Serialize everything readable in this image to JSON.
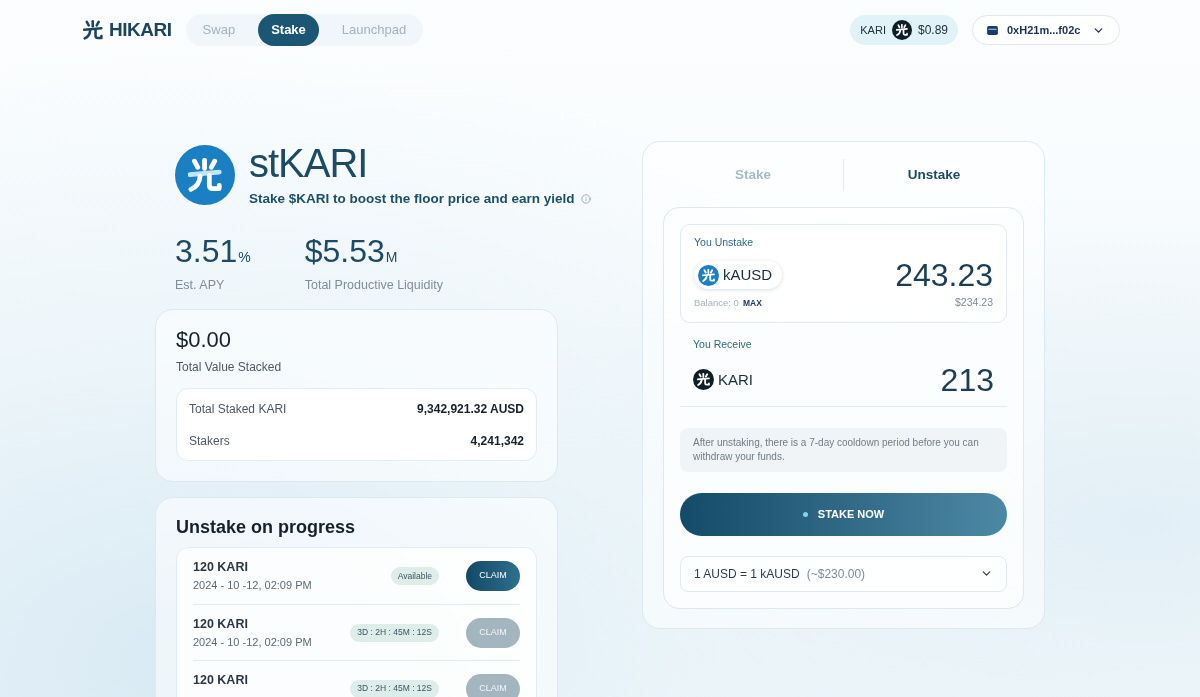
{
  "brand": {
    "name": "HIKARI"
  },
  "nav": [
    {
      "label": "Swap",
      "selected": false
    },
    {
      "label": "Stake",
      "selected": true
    },
    {
      "label": "Launchpad",
      "selected": false
    }
  ],
  "price_chip": {
    "symbol": "KARI",
    "price": "$0.89"
  },
  "wallet": {
    "address": "0xH21m...f02c"
  },
  "token": {
    "name": "stKARI",
    "tagline": "Stake $KARI to boost the floor price and earn yield"
  },
  "stats": [
    {
      "value": "3.51",
      "unit": "%",
      "label": "Est. APY"
    },
    {
      "value": "$5.53",
      "unit": "M",
      "label": "Total Productive Liquidity"
    }
  ],
  "summary": {
    "value": "$0.00",
    "label": "Total Value Stacked",
    "rows": [
      {
        "label": "Total Staked KARI",
        "value": "9,342,921.32 AUSD"
      },
      {
        "label": "Stakers",
        "value": "4,241,342"
      }
    ]
  },
  "unstake_progress": {
    "title": "Unstake on progress",
    "items": [
      {
        "amount": "120 KARI",
        "date": "2024 - 10 -12, 02:09 PM",
        "status": "Available",
        "action": "CLAIM",
        "disabled": false
      },
      {
        "amount": "120 KARI",
        "date": "2024 - 10 -12, 02:09 PM",
        "status": "3D : 2H : 45M : 12S",
        "action": "CLAIM",
        "disabled": true
      },
      {
        "amount": "120 KARI",
        "status": "3D : 2H : 45M : 12S",
        "action": "CLAIM",
        "disabled": true
      }
    ]
  },
  "swap_panel": {
    "tabs": [
      {
        "label": "Stake",
        "selected": false
      },
      {
        "label": "Unstake",
        "selected": true
      }
    ],
    "from": {
      "label": "You Unstake",
      "token": "kAUSD",
      "amount": "243.23",
      "balance": "Balance: 0",
      "max": "MAX",
      "usd": "$234.23"
    },
    "to": {
      "label": "You Receive",
      "token": "KARI",
      "amount": "213"
    },
    "notice": "After unstaking, there is a 7-day cooldown period before you can withdraw your funds.",
    "submit": "STAKE NOW",
    "rate": {
      "text": "1 AUSD = 1 kAUSD",
      "approx": "(~$230.00)"
    }
  }
}
